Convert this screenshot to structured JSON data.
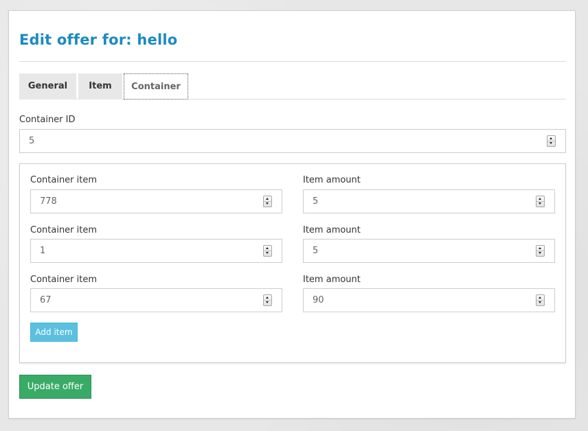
{
  "page": {
    "title": "Edit offer for: hello"
  },
  "tabs": [
    {
      "label": "General",
      "active": false
    },
    {
      "label": "Item",
      "active": false
    },
    {
      "label": "Container",
      "active": true
    }
  ],
  "container_id": {
    "label": "Container ID",
    "value": "5"
  },
  "container_items": [
    {
      "item_label": "Container item",
      "item_value": "778",
      "amount_label": "Item amount",
      "amount_value": "5"
    },
    {
      "item_label": "Container item",
      "item_value": "1",
      "amount_label": "Item amount",
      "amount_value": "5"
    },
    {
      "item_label": "Container item",
      "item_value": "67",
      "amount_label": "Item amount",
      "amount_value": "90"
    }
  ],
  "buttons": {
    "add_item": "Add item",
    "update_offer": "Update offer"
  },
  "colors": {
    "title": "#1a8bc0",
    "add_button": "#5bc0de",
    "update_button": "#3aab67"
  }
}
